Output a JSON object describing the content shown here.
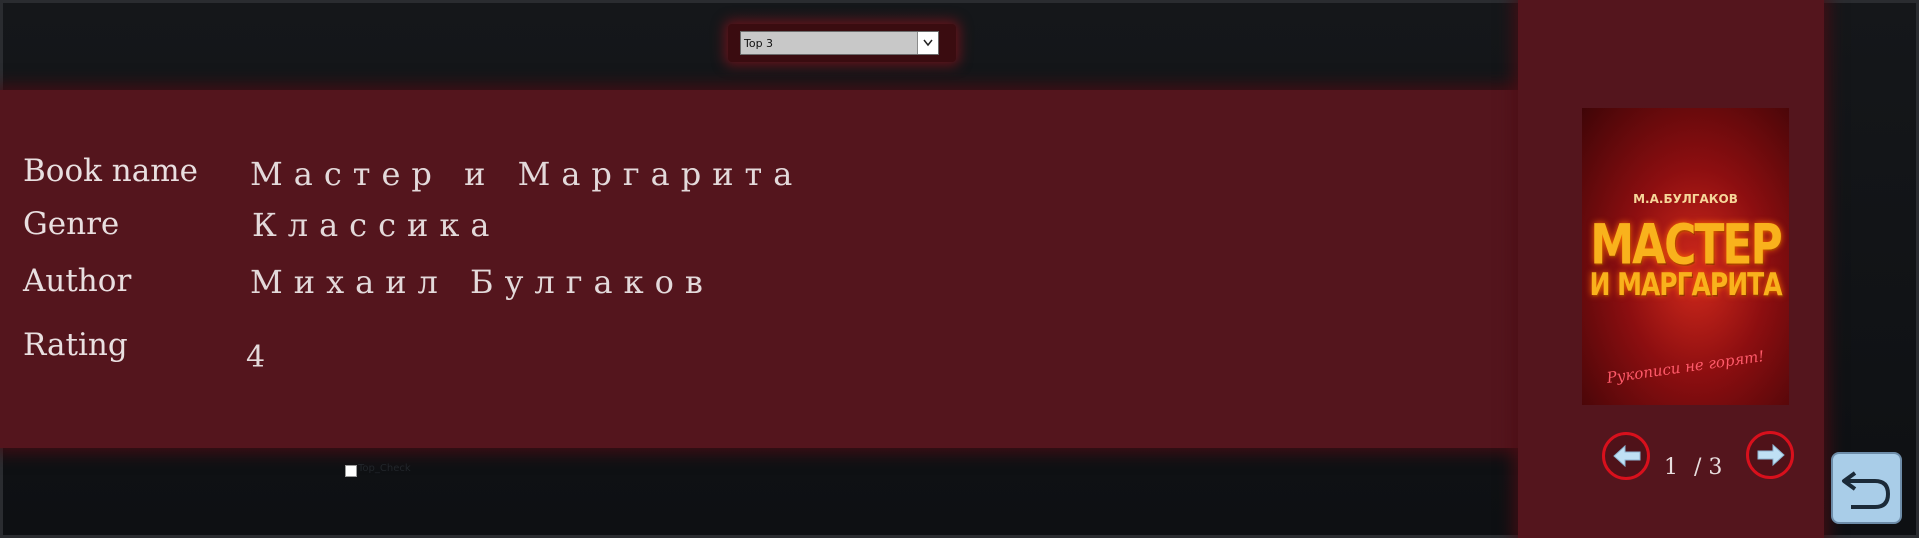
{
  "top_filter": {
    "selected": "Top 3"
  },
  "book": {
    "labels": {
      "name": "Book name",
      "genre": "Genre",
      "author": "Author",
      "rating": "Rating"
    },
    "values": {
      "name": "Мастер и Маргарита",
      "genre": "Классика",
      "author": "Михаил Булгаков",
      "rating": "4"
    }
  },
  "cover": {
    "author": "М.А.БУЛГАКОВ",
    "title_line1": "МАСТЕР",
    "title_line2": "И МАРГАРИТА",
    "tagline": "Рукописи не горят!"
  },
  "pager": {
    "current": "1",
    "total": "/ 3"
  },
  "checkbox": {
    "label": "Top_Check"
  },
  "icons": {
    "prev": "arrow-left-icon",
    "next": "arrow-right-icon",
    "back": "undo-return-icon",
    "dropdown": "chevron-down-icon"
  },
  "colors": {
    "panel": "#54151d",
    "background": "#0f1114",
    "nav_border": "#d8101c",
    "back_button": "#a9cde8"
  }
}
